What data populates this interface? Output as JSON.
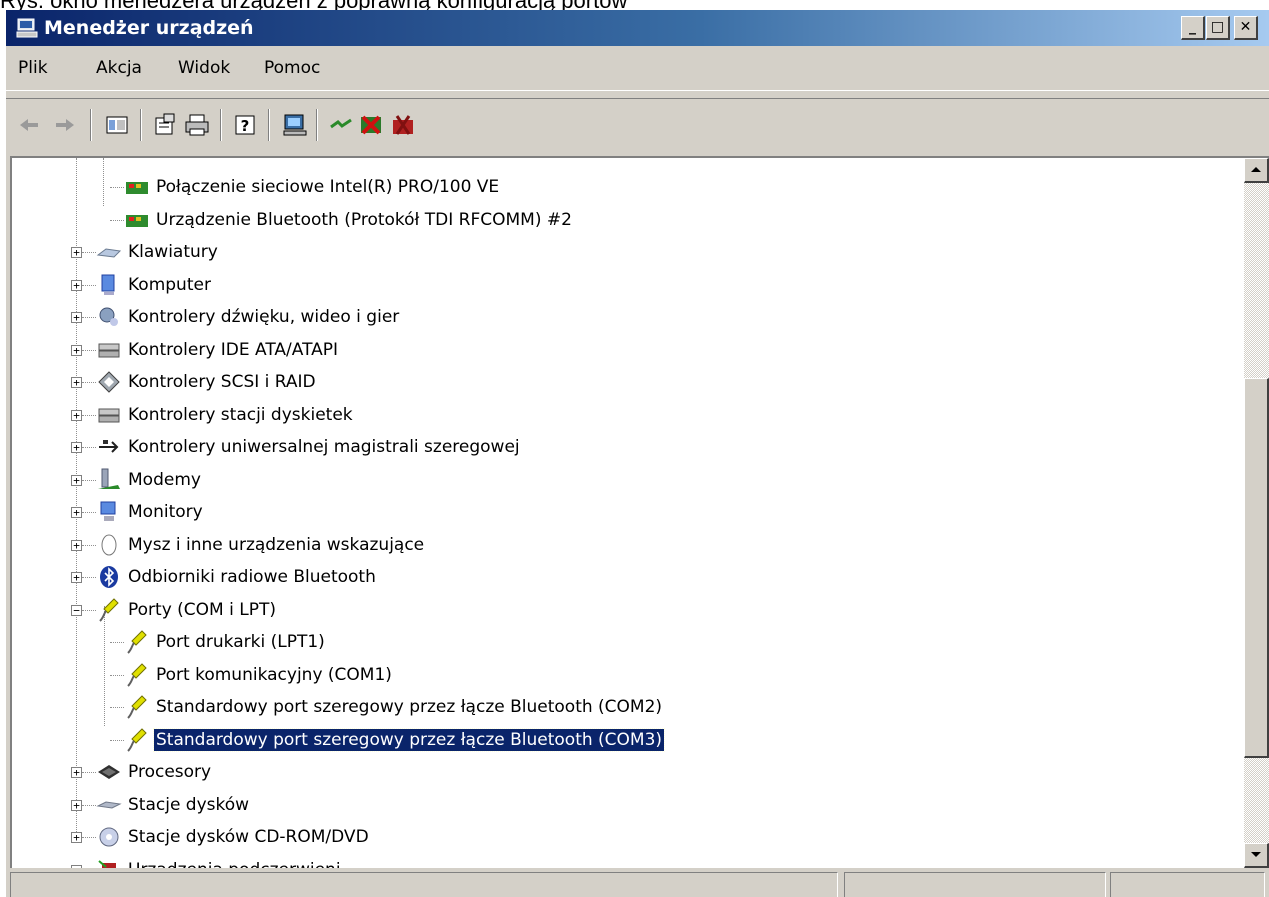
{
  "caption": "Rys. okno menedżera urządzeń z poprawną konfiguracją portów",
  "window": {
    "title": "Menedżer urządzeń",
    "controls": {
      "minimize": "_",
      "maximize": "□",
      "close": "✕"
    }
  },
  "menu": [
    "Plik",
    "Akcja",
    "Widok",
    "Pomoc"
  ],
  "toolbar_icons": [
    "back-arrow-icon",
    "forward-arrow-icon",
    "show-hide-console-tree-icon",
    "properties-icon",
    "print-icon",
    "help-icon",
    "scan-hardware-icon",
    "update-driver-icon",
    "disable-device-icon",
    "uninstall-device-icon"
  ],
  "tree": {
    "items": [
      {
        "label": "Połączenie sieciowe Intel(R) PRO/100 VE",
        "icon": "network-adapter-icon",
        "level": 1
      },
      {
        "label": "Urządzenie Bluetooth (Protokół TDI RFCOMM) #2",
        "icon": "network-adapter-icon",
        "level": 1
      },
      {
        "label": "Klawiatury",
        "icon": "keyboard-icon",
        "level": 0,
        "expander": "+"
      },
      {
        "label": "Komputer",
        "icon": "computer-icon",
        "level": 0,
        "expander": "+"
      },
      {
        "label": "Kontrolery dźwięku, wideo i gier",
        "icon": "sound-icon",
        "level": 0,
        "expander": "+"
      },
      {
        "label": "Kontrolery IDE ATA/ATAPI",
        "icon": "ide-controller-icon",
        "level": 0,
        "expander": "+"
      },
      {
        "label": "Kontrolery SCSI i RAID",
        "icon": "scsi-icon",
        "level": 0,
        "expander": "+"
      },
      {
        "label": "Kontrolery stacji dyskietek",
        "icon": "floppy-controller-icon",
        "level": 0,
        "expander": "+"
      },
      {
        "label": "Kontrolery uniwersalnej magistrali szeregowej",
        "icon": "usb-icon",
        "level": 0,
        "expander": "+"
      },
      {
        "label": "Modemy",
        "icon": "modem-icon",
        "level": 0,
        "expander": "+"
      },
      {
        "label": "Monitory",
        "icon": "monitor-icon",
        "level": 0,
        "expander": "+"
      },
      {
        "label": "Mysz i inne urządzenia wskazujące",
        "icon": "mouse-icon",
        "level": 0,
        "expander": "+"
      },
      {
        "label": "Odbiorniki radiowe Bluetooth",
        "icon": "bluetooth-icon",
        "level": 0,
        "expander": "+"
      },
      {
        "label": "Porty (COM i LPT)",
        "icon": "port-icon",
        "level": 0,
        "expander": "−"
      },
      {
        "label": "Port drukarki (LPT1)",
        "icon": "port-icon",
        "level": 1
      },
      {
        "label": "Port komunikacyjny (COM1)",
        "icon": "port-icon",
        "level": 1
      },
      {
        "label": "Standardowy port szeregowy przez łącze Bluetooth (COM2)",
        "icon": "port-icon",
        "level": 1
      },
      {
        "label": "Standardowy port szeregowy przez łącze Bluetooth (COM3)",
        "icon": "port-icon",
        "level": 1,
        "selected": true
      },
      {
        "label": "Procesory",
        "icon": "processor-icon",
        "level": 0,
        "expander": "+"
      },
      {
        "label": "Stacje dysków",
        "icon": "disk-drive-icon",
        "level": 0,
        "expander": "+"
      },
      {
        "label": "Stacje dysków CD-ROM/DVD",
        "icon": "cdrom-icon",
        "level": 0,
        "expander": "+"
      },
      {
        "label": "Urządzenia podczerwieni",
        "icon": "infrared-icon",
        "level": 0,
        "expander": "+"
      }
    ]
  },
  "colors": {
    "selection": "#0a246a",
    "title_start": "#0a246a",
    "title_end": "#a6caf0",
    "face": "#d4d0c8"
  }
}
